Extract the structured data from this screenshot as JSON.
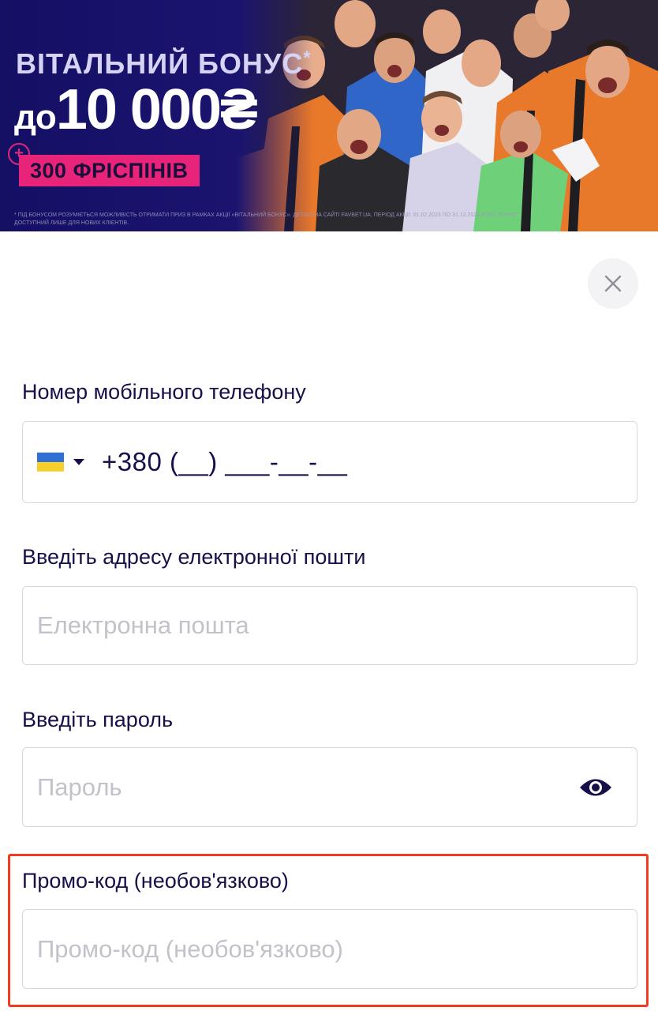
{
  "banner": {
    "title": "ВІТАЛЬНИЙ БОНУС",
    "title_star": "*",
    "amount_prefix": "до",
    "amount": "10 000₴",
    "freespins": "300 ФРІСПІНІВ",
    "plus_symbol": "+",
    "disclaimer": "* ПІД БОНУСОМ РОЗУМІЄТЬСЯ МОЖЛИВІСТЬ ОТРИМАТИ ПРИЗ В РАМКАХ АКЦІЇ «ВІТАЛЬНИЙ БОНУС». ДЕТАЛІ НА САЙТІ FAVBET.UA. ПЕРІОД АКЦІЇ: 01.02.2023 ПО 31.12.2024 РОКУ. БОНУС ДОСТУПНИЙ ЛИШЕ ДЛЯ НОВИХ КЛІЄНТІВ.",
    "colors": {
      "accent_pink": "#e8247a",
      "background_navy": "#141064"
    }
  },
  "close_icon": "close-icon",
  "form": {
    "phone": {
      "label": "Номер мобільного телефону",
      "country_flag": "ukraine-flag-icon",
      "mask": "+380 (__) ___-__-__"
    },
    "email": {
      "label": "Введіть адресу електронної пошти",
      "placeholder": "Електронна пошта",
      "value": ""
    },
    "password": {
      "label": "Введіть пароль",
      "placeholder": "Пароль",
      "value": "",
      "toggle_icon": "eye-icon"
    },
    "promo": {
      "label": "Промо-код (необов'язково)",
      "placeholder": "Промо-код (необов'язково)",
      "value": ""
    }
  },
  "colors": {
    "text_primary": "#16104a",
    "placeholder": "#c2c2ca",
    "highlight_border": "#f23a1f"
  }
}
